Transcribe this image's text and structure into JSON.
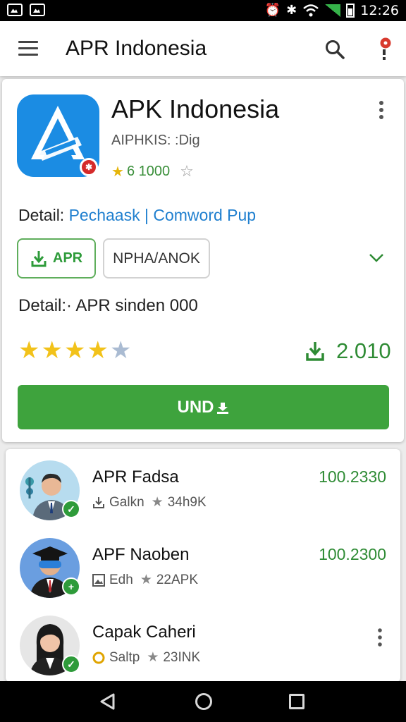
{
  "status_bar": {
    "time": "12:26",
    "left_icons": [
      "image-icon",
      "gallery-icon"
    ],
    "right_icons": [
      "alarm-icon",
      "bluetooth-icon",
      "wifi-icon",
      "signal-icon",
      "battery-icon"
    ]
  },
  "app_bar": {
    "title": "APR Indonesia",
    "icons": [
      "menu-icon",
      "search-icon",
      "notification-icon"
    ]
  },
  "app_card": {
    "name": "APK Indonesia",
    "developer": "AIPHKIS: :Dig",
    "rating_text": "6 1000",
    "detail_prefix": "Detail:",
    "detail_link1": "Pechaask",
    "detail_separator": "|",
    "detail_link2": "Comword Pup",
    "btn_apr_label": "APR",
    "btn_nph_label": "NPHA/ANOK",
    "detail2": "Detail:· APR sinden 000",
    "star_rating": 4,
    "star_max": 5,
    "download_count": "2.010",
    "install_label": "UND",
    "install_icon": "download-tray-icon"
  },
  "list_items": [
    {
      "name": "APR Fadsa",
      "meta_icon": "download-icon",
      "meta_text": "Galkn",
      "meta_star_text": "34h9K",
      "value": "100.2330",
      "badge_icon": "check-icon",
      "avatar": "man-in-suit"
    },
    {
      "name": "APF Naoben",
      "meta_icon": "image-icon",
      "meta_text": "Edh",
      "meta_star_text": "22APK",
      "value": "100.2300",
      "badge_icon": "plus-icon",
      "avatar": "graduate-with-goggles"
    },
    {
      "name": "Capak Caheri",
      "meta_icon": "coin-icon",
      "meta_text": "Saltp",
      "meta_star_text": "23INK",
      "value": "",
      "badge_icon": "check-icon",
      "avatar": "woman-in-suit"
    }
  ],
  "nav_bar": {
    "icons": [
      "back-icon",
      "home-icon",
      "recents-icon"
    ]
  },
  "colors": {
    "accent_green": "#3ea33d",
    "link_blue": "#1f7fcf",
    "logo_blue": "#1b8ce3",
    "star_yellow": "#f2c21a"
  }
}
